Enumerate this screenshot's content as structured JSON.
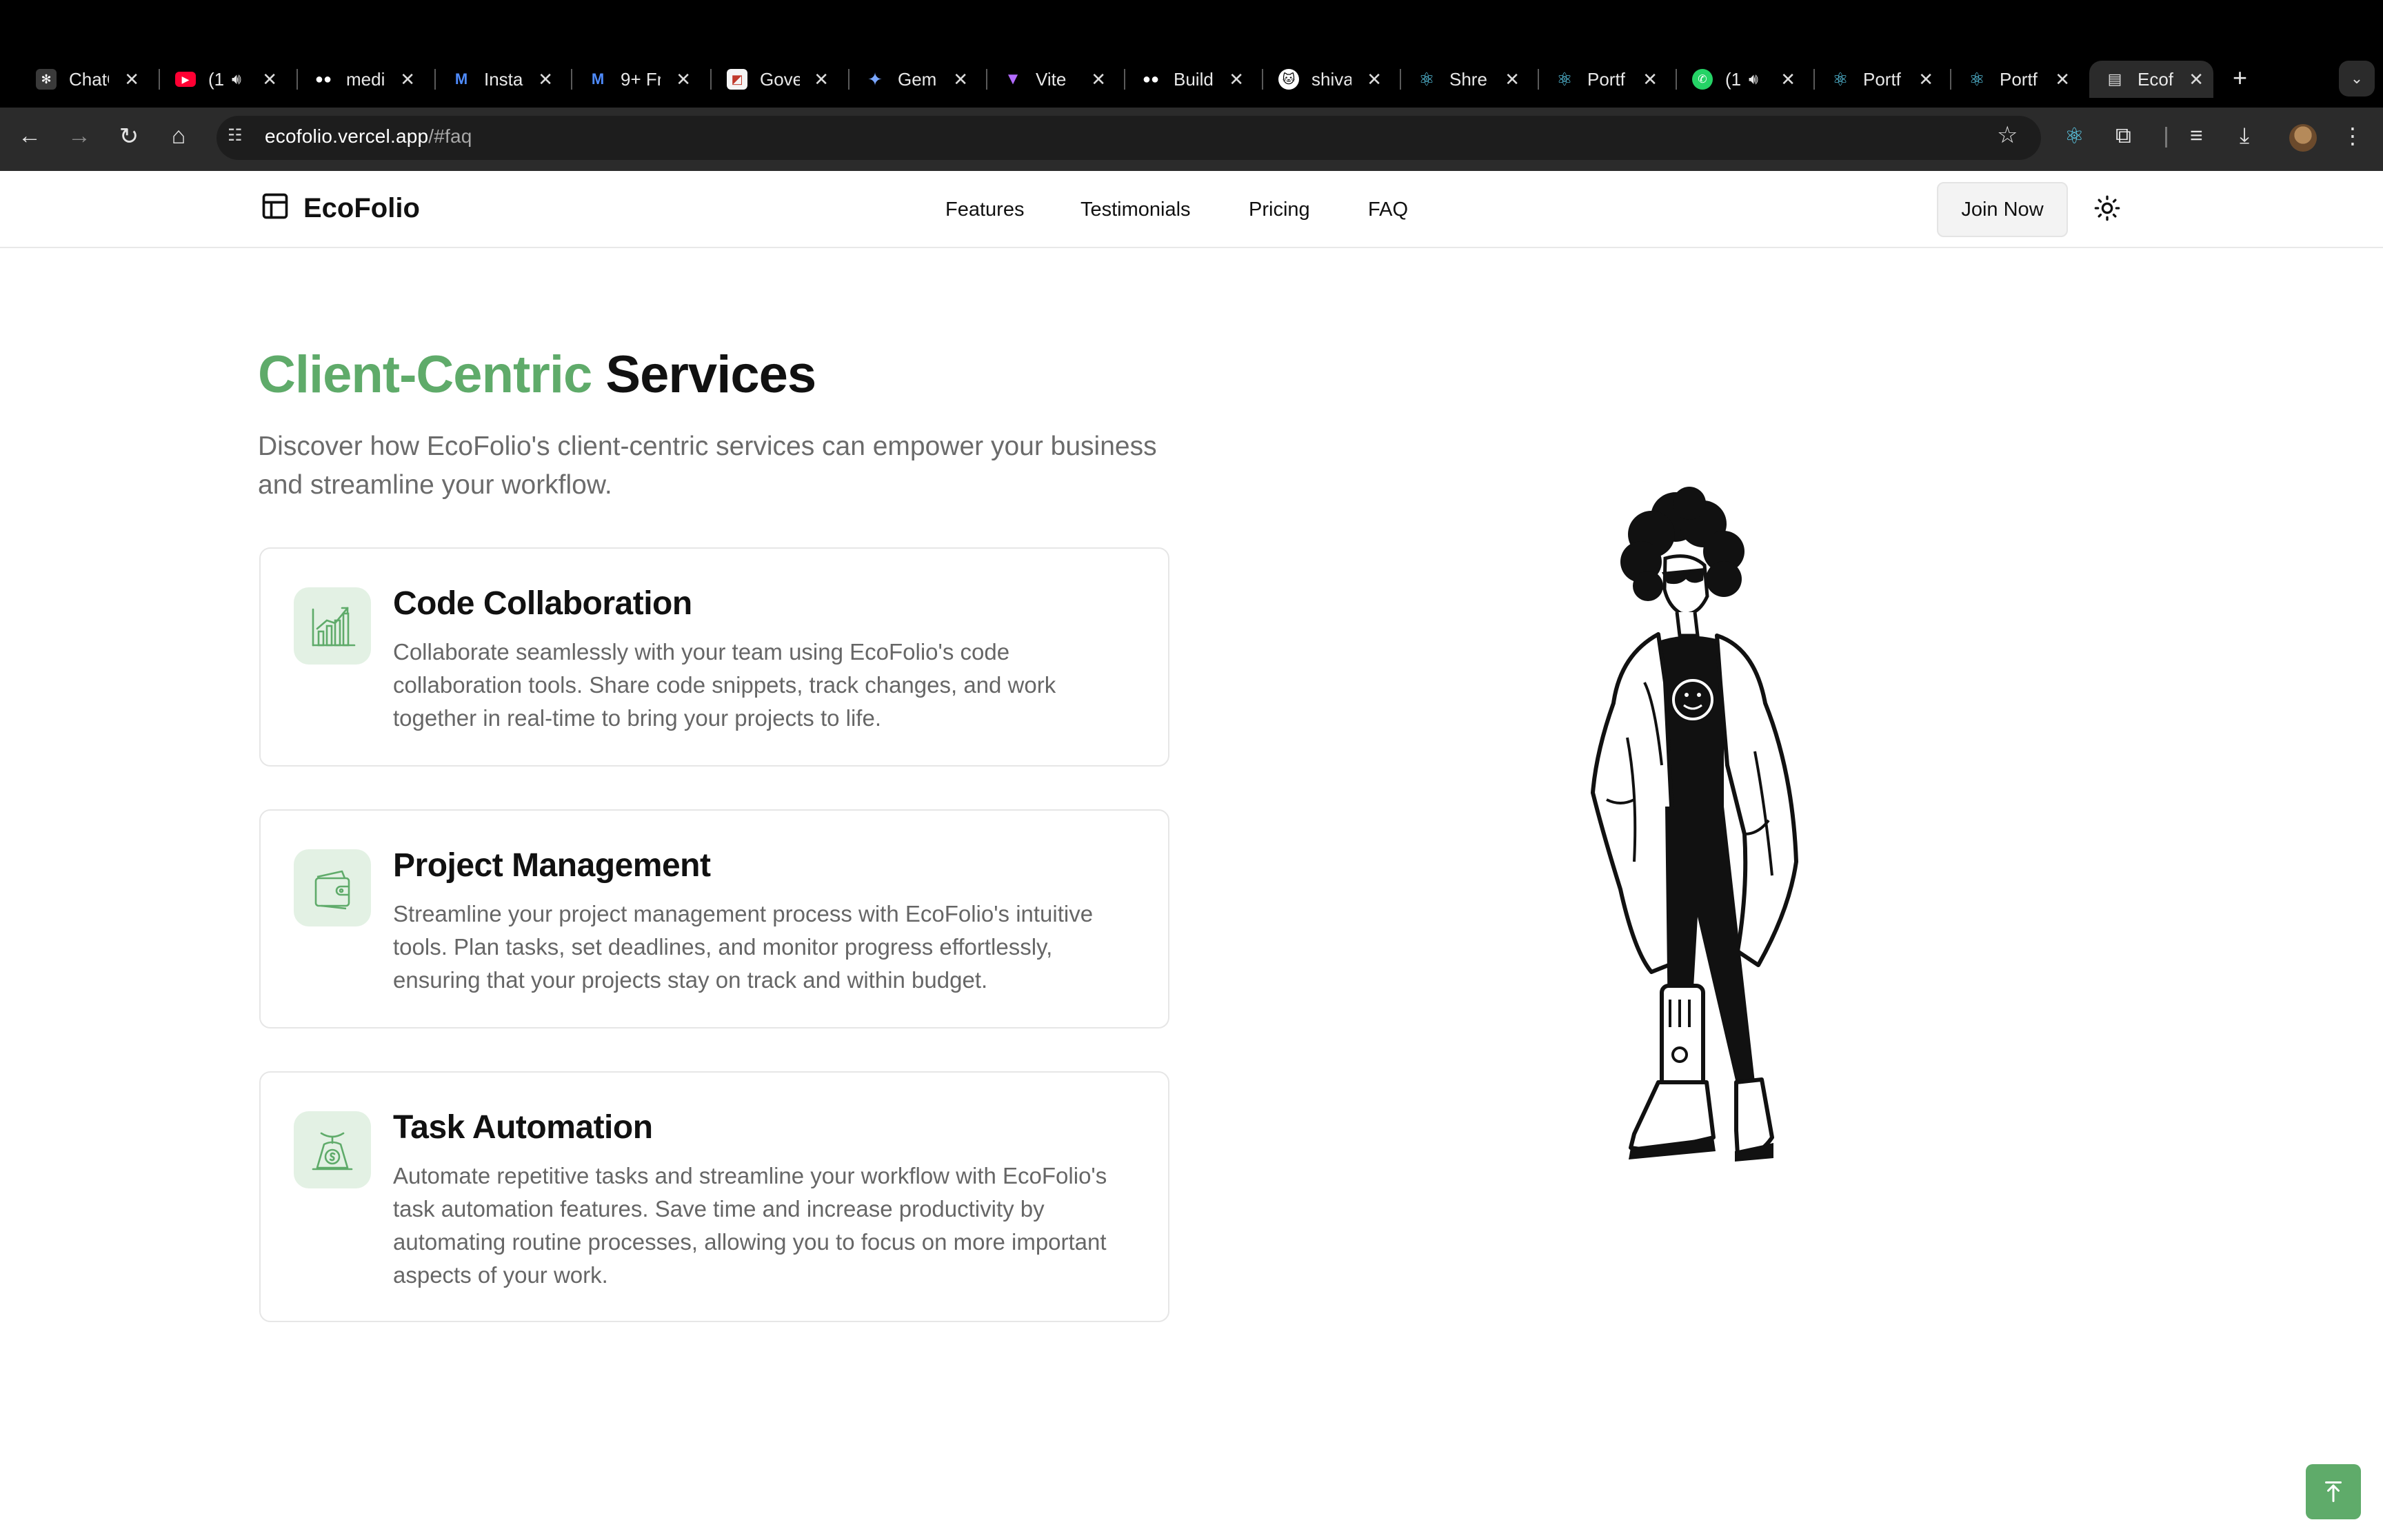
{
  "browser": {
    "tabs": [
      {
        "title": "ChatGPT",
        "icon": "chatgpt-icon"
      },
      {
        "title": "(1",
        "icon": "youtube-icon",
        "audio": true
      },
      {
        "title": "medi",
        "icon": "medium-icon"
      },
      {
        "title": "Insta",
        "icon": "mui-icon"
      },
      {
        "title": "9+ Fr",
        "icon": "mui-icon"
      },
      {
        "title": "Gove",
        "icon": "site-icon"
      },
      {
        "title": "Gemi",
        "icon": "gemini-icon"
      },
      {
        "title": "Vite",
        "icon": "vite-icon"
      },
      {
        "title": "Build",
        "icon": "medium-icon"
      },
      {
        "title": "shiva",
        "icon": "github-icon"
      },
      {
        "title": "Shre",
        "icon": "react-icon"
      },
      {
        "title": "Portf",
        "icon": "react-icon"
      },
      {
        "title": "(1",
        "icon": "whatsapp-icon",
        "audio": true
      },
      {
        "title": "Portf",
        "icon": "react-icon"
      },
      {
        "title": "Portf",
        "icon": "react-icon"
      },
      {
        "title": "Ecof",
        "icon": "layout-icon",
        "active": true
      }
    ],
    "url_host": "ecofolio.vercel.app",
    "url_path": "/#faq"
  },
  "site": {
    "brand": "EcoFolio",
    "nav": [
      "Features",
      "Testimonials",
      "Pricing",
      "FAQ"
    ],
    "join_label": "Join Now"
  },
  "hero": {
    "title_accent": "Client-Centric",
    "title_rest": " Services",
    "description": "Discover how EcoFolio's client-centric services can empower your business and streamline your workflow."
  },
  "cards": [
    {
      "title": "Code Collaboration",
      "body": "Collaborate seamlessly with your team using EcoFolio's code collaboration tools. Share code snippets, track changes, and work together in real-time to bring your projects to life.",
      "icon": "chart-growth-icon"
    },
    {
      "title": "Project Management",
      "body": "Streamline your project management process with EcoFolio's intuitive tools. Plan tasks, set deadlines, and monitor progress effortlessly, ensuring that your projects stay on track and within budget.",
      "icon": "wallet-icon"
    },
    {
      "title": "Task Automation",
      "body": "Automate repetitive tasks and streamline your workflow with EcoFolio's task automation features. Save time and increase productivity by automating routine processes, allowing you to focus on more important aspects of your work.",
      "icon": "money-scale-icon"
    }
  ],
  "colors": {
    "accent": "#5fab6a",
    "icon_bg": "#e3f1e4"
  }
}
